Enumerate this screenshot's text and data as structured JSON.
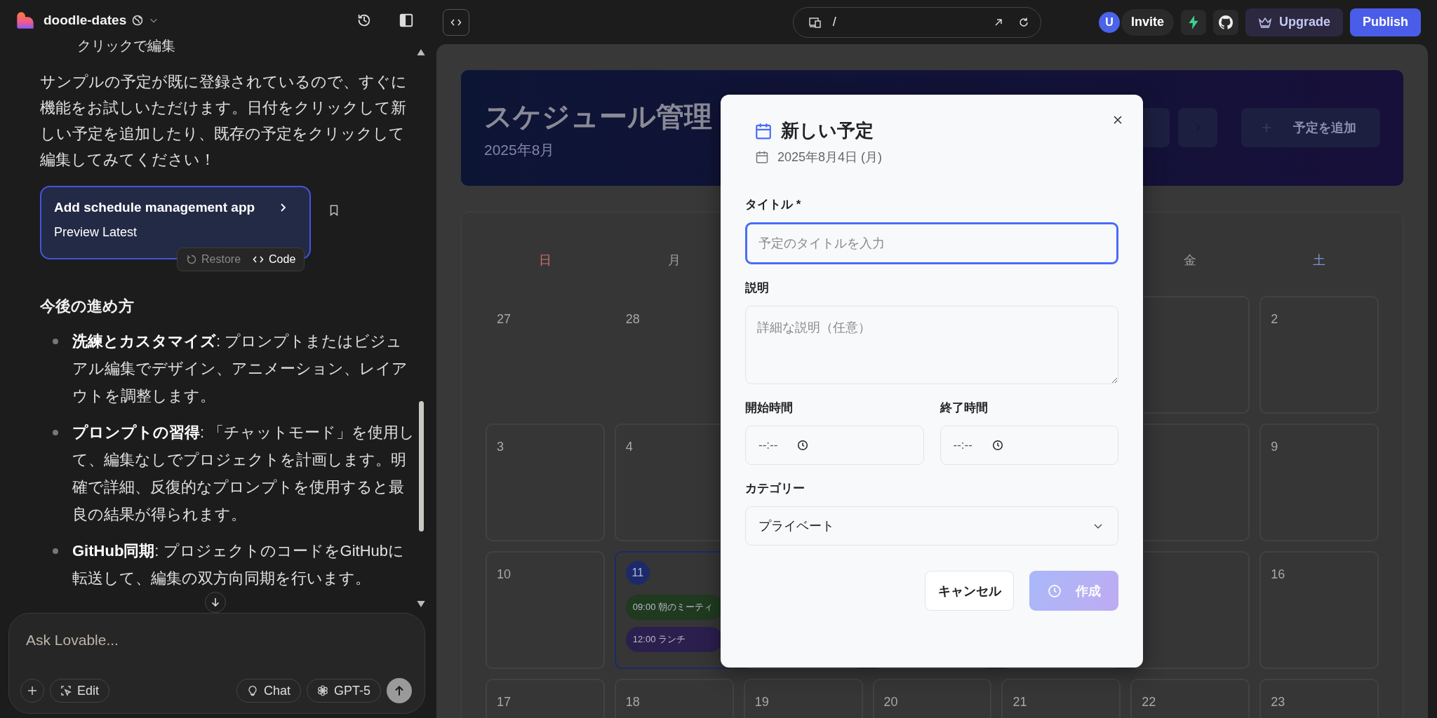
{
  "project": {
    "name": "doodle-dates"
  },
  "chat": {
    "cut_line": "クリックで編集",
    "paragraph": "サンプルの予定が既に登録されているので、すぐに機能をお試しいただけます。日付をクリックして新しい予定を追加したり、既存の予定をクリックして編集してみてください！",
    "version_card": {
      "title": "Add schedule management app",
      "subtitle": "Preview Latest"
    },
    "version_actions": [
      {
        "label": "Restore",
        "disabled": true
      },
      {
        "label": "Code",
        "disabled": false
      }
    ],
    "heading": "今後の進め方",
    "bullets": [
      "**洗練とカスタマイズ**: プロンプトまたはビジュアル編集でデザイン、アニメーション、レイアウトを調整します。",
      "**プロンプトの習得**: 「チャットモード」を使用して、編集なしでプロジェクトを計画します。明確で詳細、反復的なプロンプトを使用すると最良の結果が得られます。",
      "**GitHub同期**: プロジェクトのコードをGitHubに転送して、編集の双方向同期を行います。"
    ]
  },
  "composer": {
    "placeholder": "Ask Lovable...",
    "edit": "Edit",
    "mode": "Chat",
    "model": "GPT-5"
  },
  "topbar": {
    "path": "/",
    "avatar": "U",
    "invite": "Invite",
    "upgrade": "Upgrade",
    "publish": "Publish"
  },
  "app": {
    "title": "スケジュール管理",
    "month": "2025年8月",
    "add_button": "予定を追加",
    "weekdays": {
      "left": [
        {
          "label": "日",
          "kind": "sunday"
        },
        {
          "label": "月",
          "kind": "weekday"
        }
      ],
      "right": [
        {
          "label": "金",
          "kind": "weekday"
        },
        {
          "label": "土",
          "kind": "saturday"
        }
      ]
    },
    "weeks": [
      {
        "left": [
          {
            "day": "27",
            "other_month": true,
            "today": false
          },
          {
            "day": "28",
            "other_month": true,
            "today": false
          }
        ],
        "right": [
          {
            "day": "2",
            "other_month": false,
            "today": false
          }
        ]
      },
      {
        "left": [
          {
            "day": "3",
            "other_month": false,
            "today": false
          },
          {
            "day": "4",
            "other_month": false,
            "today": false
          }
        ],
        "right": [
          {
            "day": "9",
            "other_month": false,
            "today": false
          }
        ]
      },
      {
        "left": [
          {
            "day": "10",
            "other_month": false,
            "today": false
          },
          {
            "day": "11",
            "other_month": false,
            "today": true,
            "events": [
              {
                "time": "09:00",
                "title": "朝のミーティ",
                "color": "#1f3a1f"
              },
              {
                "time": "12:00",
                "title": "ランチ",
                "color": "#2b1f4d"
              }
            ]
          }
        ],
        "right": [
          {
            "day": "16",
            "other_month": false,
            "today": false
          }
        ]
      },
      {
        "left": [
          {
            "day": "17",
            "other_month": false,
            "today": false
          },
          {
            "day": "18",
            "other_month": false,
            "today": false
          },
          {
            "day": "19",
            "other_month": false,
            "today": false
          },
          {
            "day": "20",
            "other_month": false,
            "today": false
          },
          {
            "day": "21",
            "other_month": false,
            "today": false
          },
          {
            "day": "22",
            "other_month": false,
            "today": false
          },
          {
            "day": "23",
            "other_month": false,
            "today": false
          }
        ]
      }
    ]
  },
  "dialog": {
    "title": "新しい予定",
    "date": "2025年8月4日 (月)",
    "title_field": {
      "label": "タイトル",
      "required_mark": "*",
      "placeholder": "予定のタイトルを入力",
      "focused": true
    },
    "description_field": {
      "label": "説明",
      "placeholder": "詳細な説明（任意）"
    },
    "times": [
      {
        "label": "開始時間",
        "value": "--:--"
      },
      {
        "label": "終了時間",
        "value": "--:--"
      }
    ],
    "category_field": {
      "label": "カテゴリー",
      "value": "プライベート"
    },
    "buttons": [
      {
        "label": "キャンセル",
        "kind": "secondary",
        "disabled": false
      },
      {
        "label": "作成",
        "kind": "primary",
        "disabled": true
      }
    ]
  }
}
